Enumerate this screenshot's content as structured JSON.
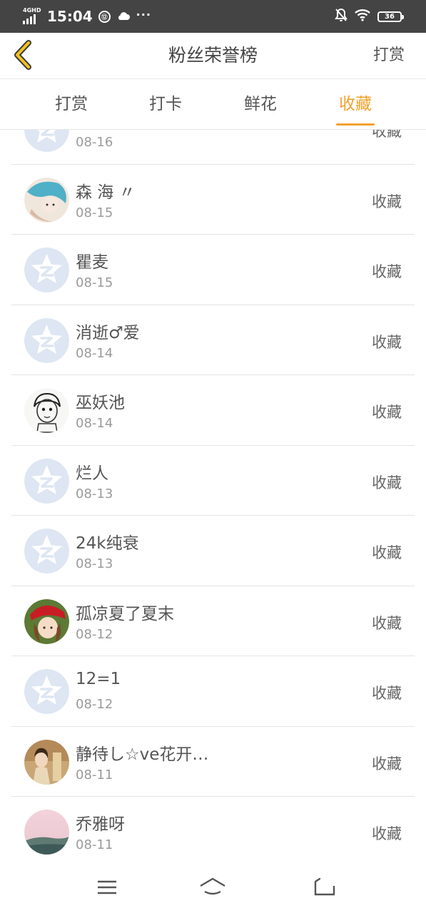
{
  "status_bar": {
    "network_type": "4GHD",
    "time": "15:04",
    "battery": "36",
    "icons": [
      "signal-icon",
      "vpn-icon",
      "cloud-icon",
      "more-dots-icon",
      "mute-bell-icon",
      "wifi-icon",
      "battery-icon"
    ]
  },
  "header": {
    "title": "粉丝荣誉榜",
    "right_action": "打赏",
    "back_icon": "chevron-left-icon",
    "accent_color": "#f2a12c"
  },
  "tabs": [
    {
      "label": "打赏",
      "active": false
    },
    {
      "label": "打卡",
      "active": false
    },
    {
      "label": "鲜花",
      "active": false
    },
    {
      "label": "收藏",
      "active": true
    }
  ],
  "list": {
    "items": [
      {
        "name": "",
        "date": "08-16",
        "action": "收藏",
        "avatar": "default"
      },
      {
        "name": "森 海 〃",
        "date": "08-15",
        "action": "收藏",
        "avatar": "photo-anime-blue"
      },
      {
        "name": "瞿麦",
        "date": "08-15",
        "action": "收藏",
        "avatar": "default"
      },
      {
        "name": "消逝♂爱",
        "date": "08-14",
        "action": "收藏",
        "avatar": "default"
      },
      {
        "name": "巫妖池",
        "date": "08-14",
        "action": "收藏",
        "avatar": "photo-sketch"
      },
      {
        "name": "烂人",
        "date": "08-13",
        "action": "收藏",
        "avatar": "default"
      },
      {
        "name": "24k纯衰",
        "date": "08-13",
        "action": "收藏",
        "avatar": "default"
      },
      {
        "name": "孤凉夏了夏末",
        "date": "08-12",
        "action": "收藏",
        "avatar": "photo-red-hat"
      },
      {
        "name": "12=1",
        "date": "08-12",
        "action": "收藏",
        "avatar": "default"
      },
      {
        "name": "静待し☆ve花开…",
        "date": "08-11",
        "action": "收藏",
        "avatar": "photo-girl"
      },
      {
        "name": "乔雅呀",
        "date": "08-11",
        "action": "收藏",
        "avatar": "photo-landscape"
      }
    ]
  },
  "bottom_nav": {
    "icons": [
      "menu-icon",
      "home-icon",
      "back-icon"
    ]
  }
}
